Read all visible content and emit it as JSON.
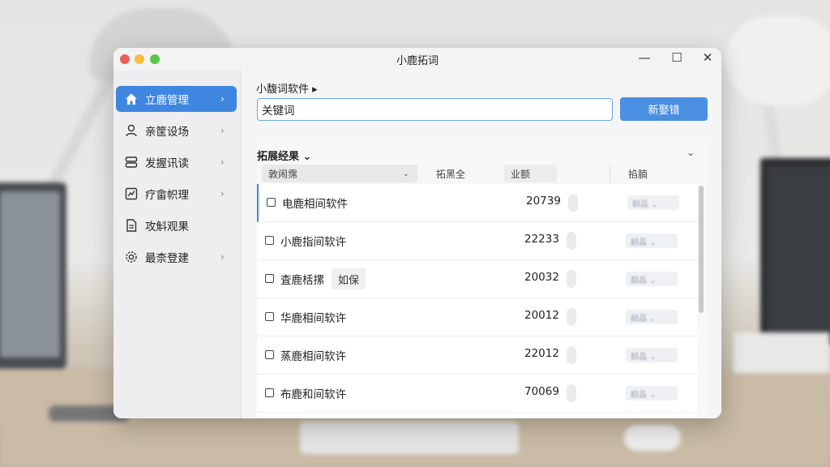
{
  "window": {
    "title": "小鹿拓词"
  },
  "window_controls": {
    "minimize": "—",
    "maximize": "☐",
    "close": "✕"
  },
  "sidebar": {
    "items": [
      {
        "label": "立鹿管理",
        "icon": "home-icon",
        "active": true
      },
      {
        "label": "亲筐设场",
        "icon": "user-icon",
        "active": false
      },
      {
        "label": "发握讯读",
        "icon": "database-icon",
        "active": false
      },
      {
        "label": "疗畲帜理",
        "icon": "chart-icon",
        "active": false
      },
      {
        "label": "攻斛观果",
        "icon": "document-icon",
        "active": false
      },
      {
        "label": "最柰登建",
        "icon": "gear-icon",
        "active": false
      }
    ],
    "chevron": "›"
  },
  "main": {
    "project_label": "小馥词软件 ▸",
    "search": {
      "value": "关键词",
      "placeholder": ""
    },
    "primary_button": "新娶错"
  },
  "results": {
    "title": "拓展经果 ⌄",
    "collapse_icon": "⌄",
    "columns": [
      "敦闹霈",
      "拓黑全",
      "业额",
      "掐腩"
    ],
    "column_dropdown": "⌄",
    "rows": [
      {
        "keyword": "电鹿相间软件",
        "tag": "",
        "volume": "20739",
        "action": "翻晶 ⌄"
      },
      {
        "keyword": "小鹿指间软许",
        "tag": "",
        "volume": "22233",
        "action": "翻晶 ⌄"
      },
      {
        "keyword": "査鹿栝摞",
        "tag": "如保",
        "volume": "20032",
        "action": "翻晶 ⌄"
      },
      {
        "keyword": "华鹿相间软许",
        "tag": "",
        "volume": "20012",
        "action": "翻晶 ⌄"
      },
      {
        "keyword": "蒸鹿相间软许",
        "tag": "",
        "volume": "22012",
        "action": "翻晶 ⌄"
      },
      {
        "keyword": "布鹿和间软许",
        "tag": "",
        "volume": "70069",
        "action": "翻晶 ⌄"
      }
    ]
  },
  "colors": {
    "accent": "#3f86e0",
    "button": "#4a8fe2",
    "input_border": "#6aa3e8"
  }
}
